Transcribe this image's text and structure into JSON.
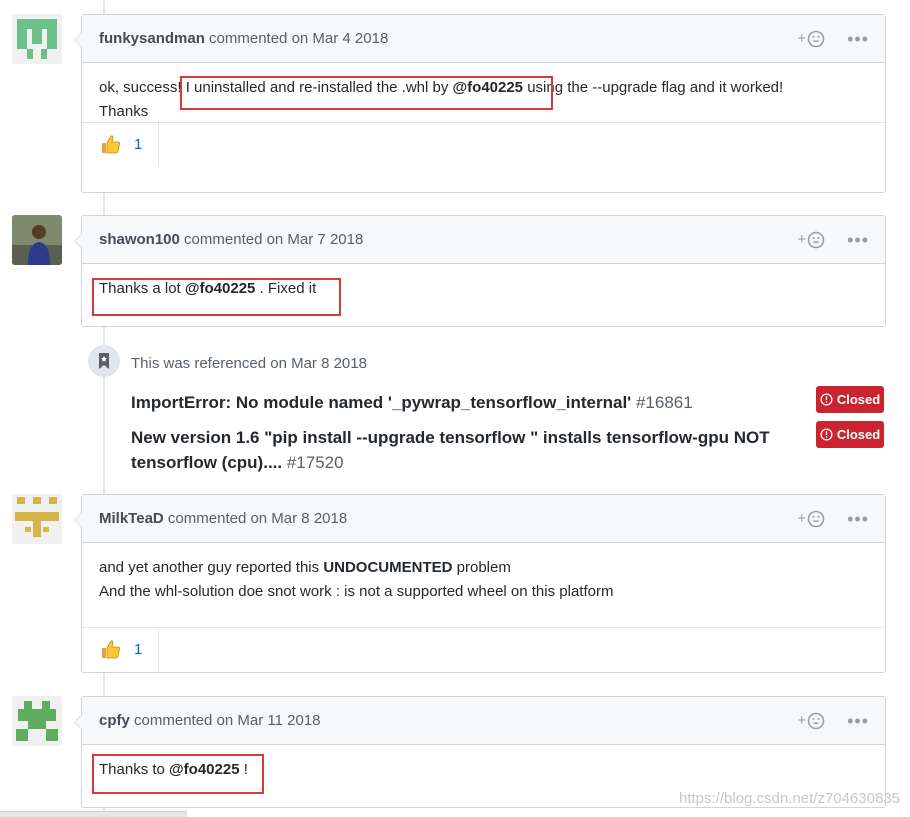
{
  "colors": {
    "accent": "#0366d6",
    "closed": "#cb2431",
    "highlight": "#d73a3a"
  },
  "comments": [
    {
      "author": "funkysandman",
      "meta": "commented on Mar 4 2018",
      "body_before": "ok, success!",
      "body_mid": " I uninstalled and re-installed the .whl by ",
      "mention": "@fo40225",
      "body_after": " using the --upgrade flag and it worked!",
      "body_line2": "Thanks",
      "reaction_icon": "thumbs-up-icon",
      "reaction_count": "1"
    },
    {
      "author": "shawon100",
      "meta": "commented on Mar 7 2018",
      "body_before": "Thanks a lot ",
      "mention": "@fo40225",
      "body_after": " . Fixed it"
    },
    {
      "author": "MilkTeaD",
      "meta": "commented on Mar 8 2018",
      "line1_before": "and yet another guy reported this ",
      "line1_bold": "UNDOCUMENTED",
      "line1_after": " problem",
      "line2": "And the whl-solution doe snot work : is not a supported wheel on this platform",
      "reaction_icon": "thumbs-up-icon",
      "reaction_count": "1"
    },
    {
      "author": "cpfy",
      "meta": "commented on Mar 11 2018",
      "body_before": "Thanks to ",
      "mention": "@fo40225",
      "body_after": " !"
    }
  ],
  "reference": {
    "text": "This was referenced on Mar 8 2018",
    "icon": "bookmark-icon",
    "items": [
      {
        "title": "ImportError: No module named '_pywrap_tensorflow_internal'",
        "number": "#16861",
        "status": "Closed"
      },
      {
        "title": "New version 1.6 \"pip install --upgrade tensorflow \" installs tensorflow-gpu NOT tensorflow (cpu)....",
        "number": "#17520",
        "status": "Closed"
      }
    ]
  },
  "header_actions": {
    "add_reaction": "+",
    "more": "•••"
  },
  "watermark": "https://blog.csdn.net/z704630835"
}
